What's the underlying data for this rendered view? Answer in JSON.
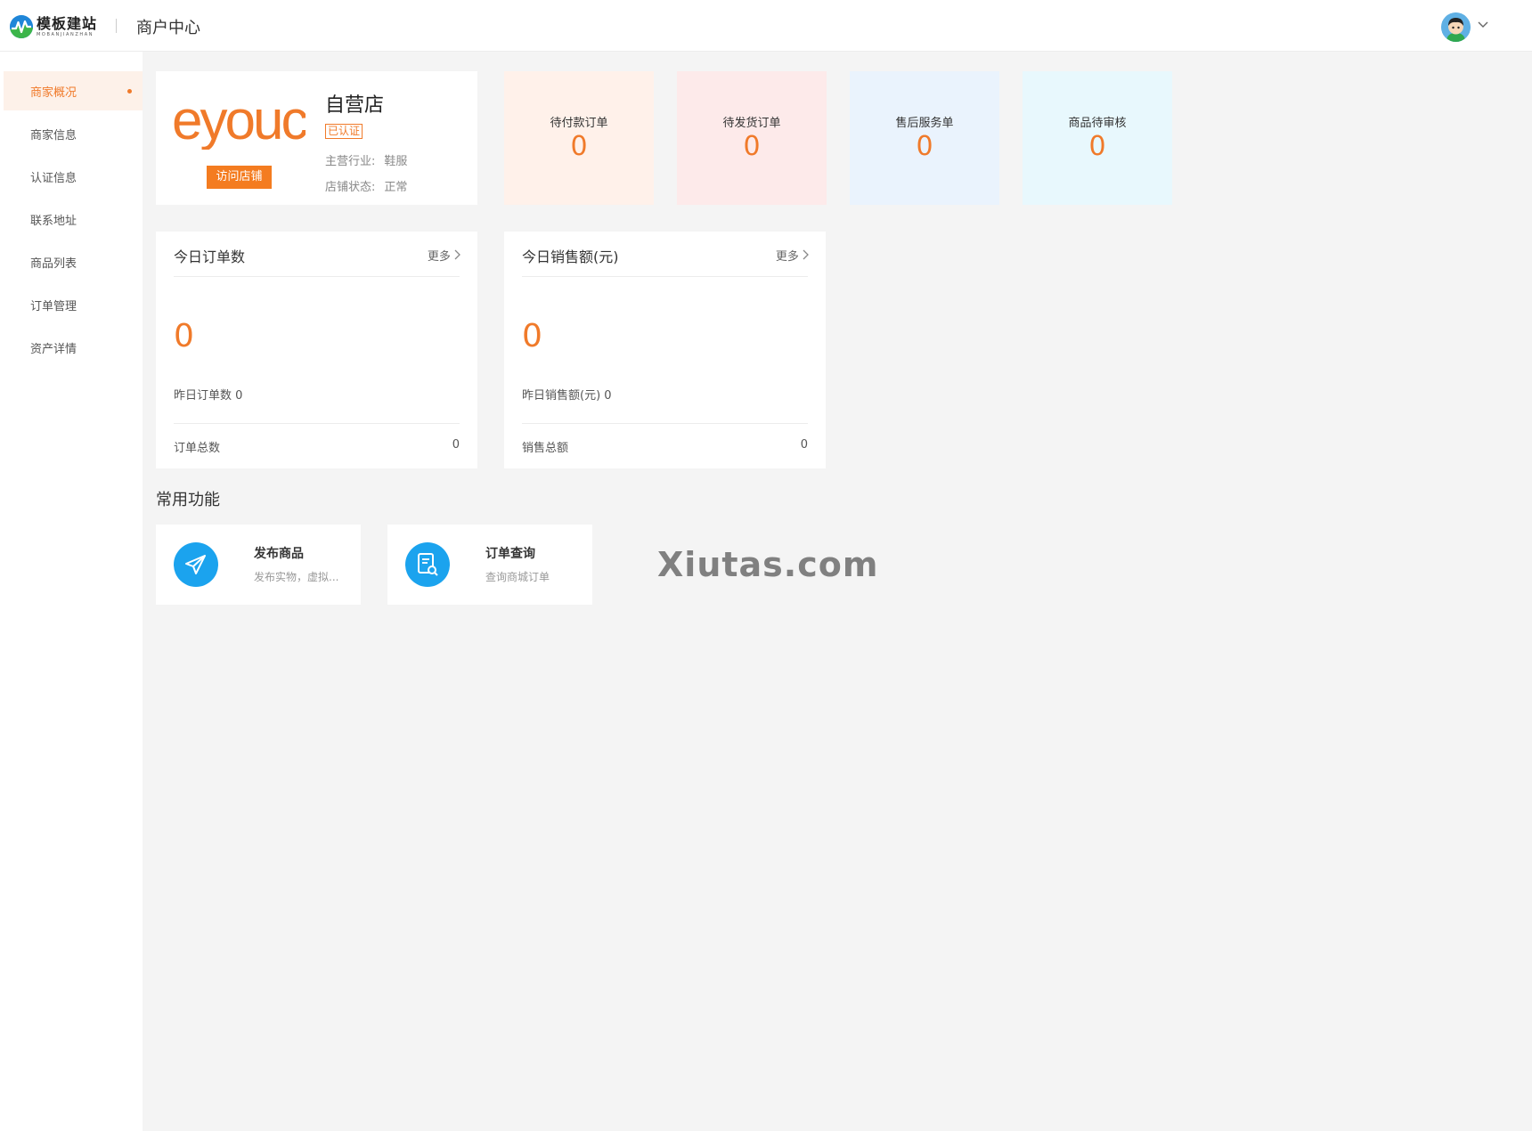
{
  "header": {
    "logo_text": "模板建站",
    "logo_sub": "MOBANJIANZHAN",
    "title": "商户中心"
  },
  "sidebar": {
    "items": [
      {
        "label": "商家概况",
        "active": true
      },
      {
        "label": "商家信息"
      },
      {
        "label": "认证信息"
      },
      {
        "label": "联系地址"
      },
      {
        "label": "商品列表"
      },
      {
        "label": "订单管理"
      },
      {
        "label": "资产详情"
      }
    ]
  },
  "shop": {
    "logo_text": "eyoucms",
    "visit_label": "访问店铺",
    "name": "自营店",
    "verified": "已认证",
    "industry_label": "主营行业:",
    "industry_value": "鞋服",
    "status_label": "店铺状态:",
    "status_value": "正常"
  },
  "stats": [
    {
      "label": "待付款订单",
      "value": "0",
      "bg": "#fff1ea"
    },
    {
      "label": "待发货订单",
      "value": "0",
      "bg": "#fdeaea"
    },
    {
      "label": "售后服务单",
      "value": "0",
      "bg": "#eaf3fd"
    },
    {
      "label": "商品待审核",
      "value": "0",
      "bg": "#e8f8fd"
    }
  ],
  "panels": [
    {
      "title": "今日订单数",
      "more": "更多",
      "value": "0",
      "yesterday": "昨日订单数 0",
      "total_label": "订单总数",
      "total_value": "0"
    },
    {
      "title": "今日销售额(元)",
      "more": "更多",
      "value": "0",
      "yesterday": "昨日销售额(元) 0",
      "total_label": "销售总额",
      "total_value": "0"
    }
  ],
  "functions": {
    "title": "常用功能",
    "items": [
      {
        "title": "发布商品",
        "desc": "发布实物，虚拟...",
        "icon": "paper-plane-icon"
      },
      {
        "title": "订单查询",
        "desc": "查询商城订单",
        "icon": "document-search-icon"
      }
    ]
  },
  "watermark": "Xiutas.com",
  "colors": {
    "accent": "#f07a2a",
    "func_icon": "#1ba3ee"
  }
}
